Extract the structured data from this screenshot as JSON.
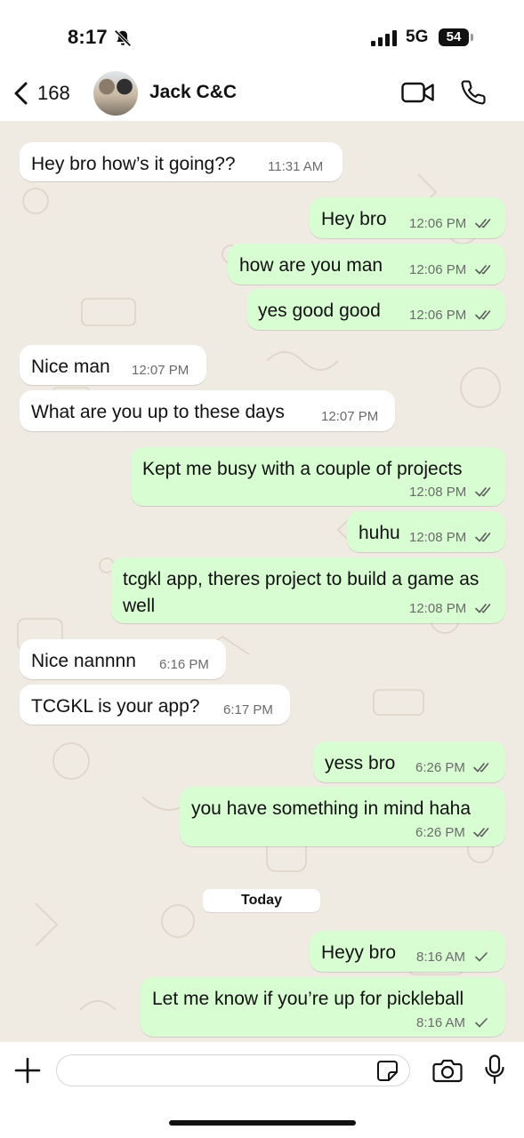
{
  "status_bar": {
    "time": "8:17",
    "network": "5G",
    "battery": "54"
  },
  "header": {
    "back_count": "168",
    "contact_name": "Jack C&C"
  },
  "messages": [
    {
      "text": "Hey bro how’s it going??",
      "time": "11:31 AM"
    },
    {
      "text": "Hey bro",
      "time": "12:06 PM",
      "status": "read"
    },
    {
      "text": "how are you man",
      "time": "12:06 PM",
      "status": "read"
    },
    {
      "text": "yes good good",
      "time": "12:06 PM",
      "status": "read"
    },
    {
      "text": "Nice man",
      "time": "12:07 PM"
    },
    {
      "text": "What are you up to these days",
      "time": "12:07 PM"
    },
    {
      "text": "Kept me busy with a couple of projects",
      "time": "12:08 PM",
      "status": "read"
    },
    {
      "text": "huhu",
      "time": "12:08 PM",
      "status": "read"
    },
    {
      "text": "tcgkl app, theres project to build a game as well",
      "time": "12:08 PM",
      "status": "read"
    },
    {
      "text": "Nice nannnn",
      "time": "6:16 PM"
    },
    {
      "text": "TCGKL is your app?",
      "time": "6:17 PM"
    },
    {
      "text": "yess bro",
      "time": "6:26 PM",
      "status": "read"
    },
    {
      "text": "you have something in mind haha",
      "time": "6:26 PM",
      "status": "read"
    },
    {
      "text": "Heyy bro",
      "time": "8:16 AM",
      "status": "sent"
    },
    {
      "text": "Let me know if you’re up for pickleball",
      "time": "8:16 AM",
      "status": "sent"
    }
  ],
  "date_separator": "Today",
  "composer": {
    "placeholder": ""
  },
  "colors": {
    "outgoing_bubble": "#d9fdd3",
    "incoming_bubble": "#ffffff",
    "wallpaper": "#efeae2",
    "read_ticks": "#5b5b5b"
  },
  "icons": [
    "bell-slash-icon",
    "signal-icon",
    "back-chevron-icon",
    "video-call-icon",
    "phone-icon",
    "double-check-icon",
    "single-check-icon",
    "add-icon",
    "sticker-icon",
    "camera-icon",
    "mic-icon"
  ]
}
